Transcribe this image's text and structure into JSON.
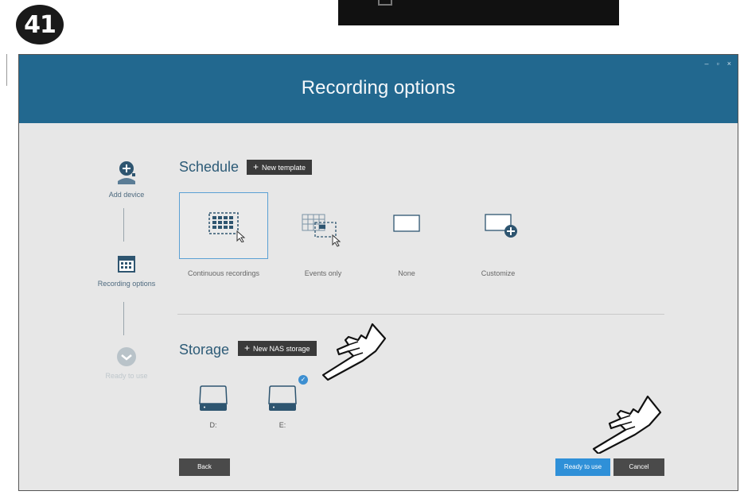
{
  "step_number": "41",
  "window": {
    "title": "Recording options",
    "controls": [
      "–",
      "▫",
      "×"
    ]
  },
  "stepper": {
    "steps": [
      {
        "label": "Add device",
        "icon": "add-device-icon",
        "state": "done"
      },
      {
        "label": "Recording options",
        "icon": "calendar-icon",
        "state": "current"
      },
      {
        "label": "Ready to use",
        "icon": "check-circle-icon",
        "state": "pending"
      }
    ]
  },
  "schedule": {
    "title": "Schedule",
    "new_template_label": "New template",
    "options": [
      {
        "label": "Continuous recordings",
        "selected": true,
        "icon": "continuous-grid-icon"
      },
      {
        "label": "Events only",
        "selected": false,
        "icon": "events-grid-icon"
      },
      {
        "label": "None",
        "selected": false,
        "icon": "blank-rect-icon"
      },
      {
        "label": "Customize",
        "selected": false,
        "icon": "customize-plus-icon"
      }
    ]
  },
  "storage": {
    "title": "Storage",
    "new_nas_label": "New NAS storage",
    "drives": [
      {
        "label": "D:",
        "selected": false
      },
      {
        "label": "E:",
        "selected": true
      }
    ]
  },
  "footer": {
    "back_label": "Back",
    "ready_label": "Ready to use",
    "cancel_label": "Cancel"
  },
  "colors": {
    "titlebar": "#22688f",
    "accent": "#2f90d8",
    "window_bg": "#e7e7e7",
    "dark_button": "#3a3a3a"
  }
}
